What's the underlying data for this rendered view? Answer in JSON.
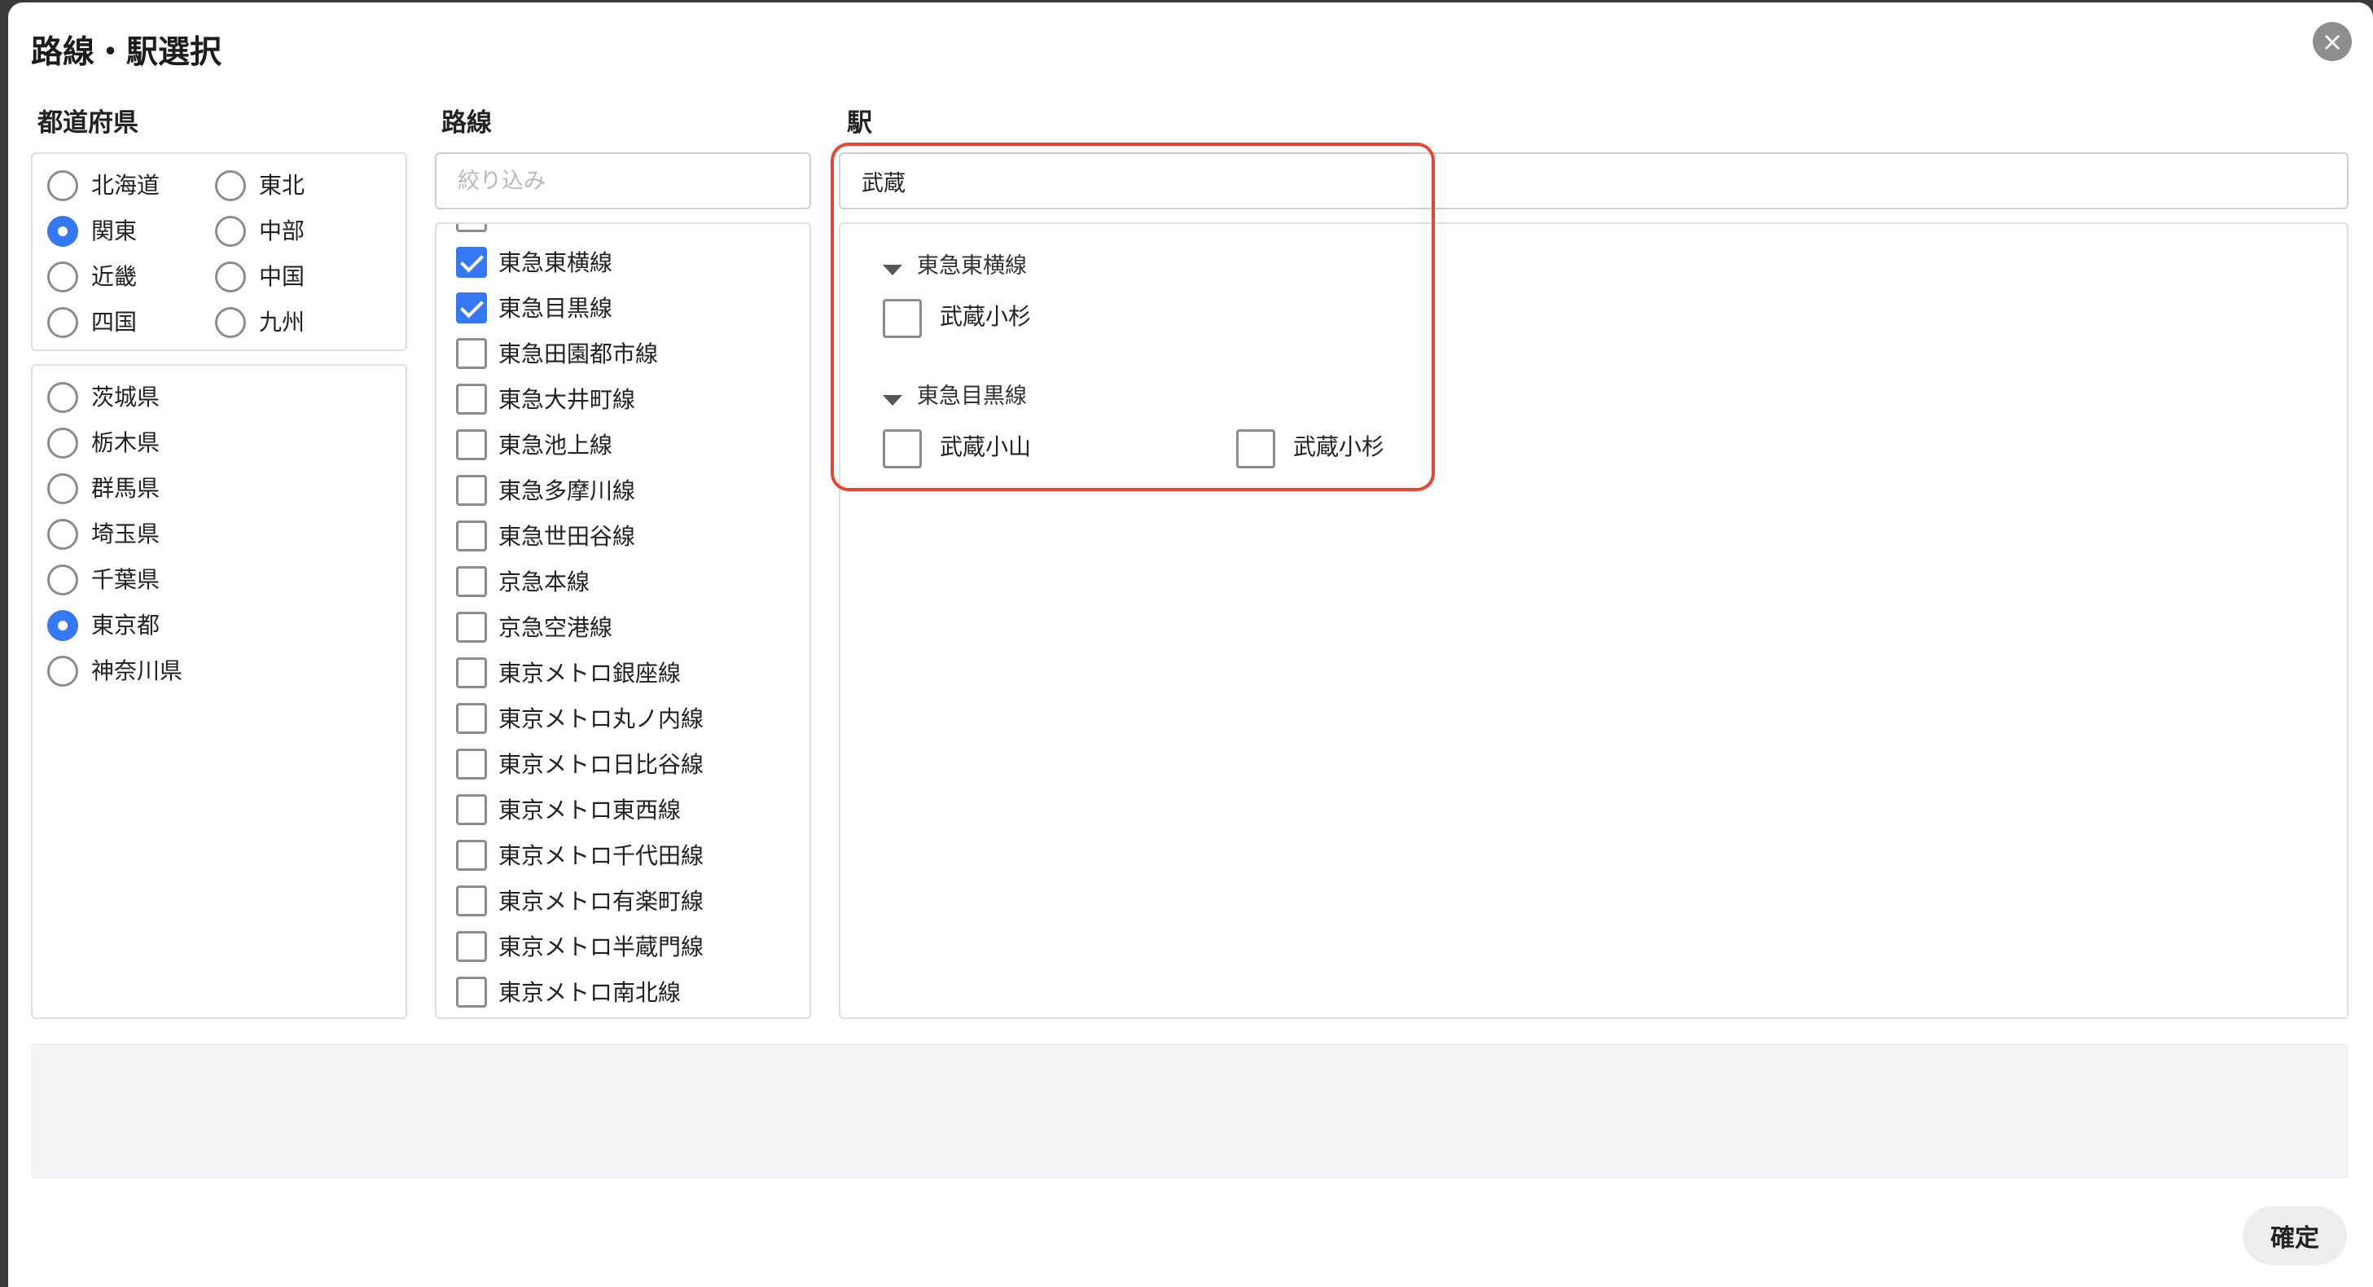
{
  "dialog": {
    "title": "路線・駅選択",
    "close_symbol": "×",
    "confirm_label": "確定"
  },
  "columns": {
    "prefecture_label": "都道府県",
    "route_label": "路線",
    "station_label": "駅"
  },
  "regions": [
    {
      "label": "北海道",
      "selected": false
    },
    {
      "label": "東北",
      "selected": false
    },
    {
      "label": "関東",
      "selected": true
    },
    {
      "label": "中部",
      "selected": false
    },
    {
      "label": "近畿",
      "selected": false
    },
    {
      "label": "中国",
      "selected": false
    },
    {
      "label": "四国",
      "selected": false
    },
    {
      "label": "九州",
      "selected": false
    }
  ],
  "prefectures": [
    {
      "label": "茨城県",
      "selected": false
    },
    {
      "label": "栃木県",
      "selected": false
    },
    {
      "label": "群馬県",
      "selected": false
    },
    {
      "label": "埼玉県",
      "selected": false
    },
    {
      "label": "千葉県",
      "selected": false
    },
    {
      "label": "東京都",
      "selected": true
    },
    {
      "label": "神奈川県",
      "selected": false
    }
  ],
  "route_filter": {
    "placeholder": "絞り込み",
    "value": ""
  },
  "routes": [
    {
      "label": "東急東横線",
      "checked": true
    },
    {
      "label": "東急目黒線",
      "checked": true
    },
    {
      "label": "東急田園都市線",
      "checked": false
    },
    {
      "label": "東急大井町線",
      "checked": false
    },
    {
      "label": "東急池上線",
      "checked": false
    },
    {
      "label": "東急多摩川線",
      "checked": false
    },
    {
      "label": "東急世田谷線",
      "checked": false
    },
    {
      "label": "京急本線",
      "checked": false
    },
    {
      "label": "京急空港線",
      "checked": false
    },
    {
      "label": "東京メトロ銀座線",
      "checked": false
    },
    {
      "label": "東京メトロ丸ノ内線",
      "checked": false
    },
    {
      "label": "東京メトロ日比谷線",
      "checked": false
    },
    {
      "label": "東京メトロ東西線",
      "checked": false
    },
    {
      "label": "東京メトロ千代田線",
      "checked": false
    },
    {
      "label": "東京メトロ有楽町線",
      "checked": false
    },
    {
      "label": "東京メトロ半蔵門線",
      "checked": false
    },
    {
      "label": "東京メトロ南北線",
      "checked": false
    }
  ],
  "station_filter": {
    "value": "武蔵"
  },
  "station_groups": [
    {
      "route": "東急東横線",
      "stations": [
        {
          "label": "武蔵小杉",
          "checked": false
        }
      ]
    },
    {
      "route": "東急目黒線",
      "stations": [
        {
          "label": "武蔵小山",
          "checked": false
        },
        {
          "label": "武蔵小杉",
          "checked": false
        }
      ]
    }
  ],
  "colors": {
    "accent": "#3478f6",
    "highlight": "#e64532"
  }
}
